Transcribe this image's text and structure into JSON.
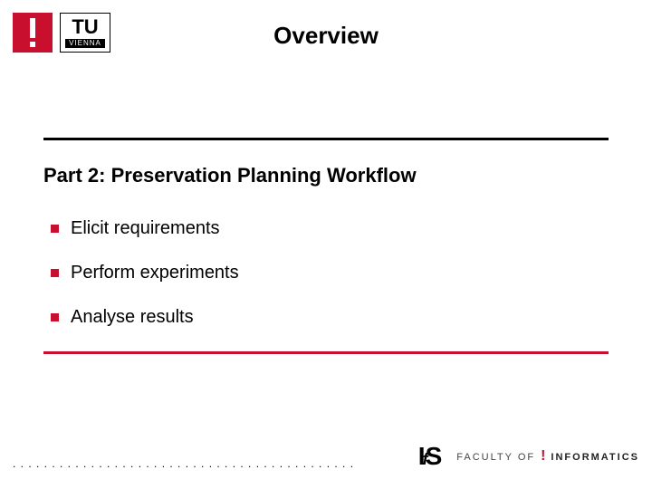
{
  "accent_color": "#c8102e",
  "header": {
    "institution_code": "TU",
    "institution_city": "VIENNA"
  },
  "title": "Overview",
  "subtitle": "Part 2: Preservation Planning Workflow",
  "bullets": [
    "Elicit requirements",
    "Perform experiments",
    "Analyse results"
  ],
  "footer": {
    "ifs_logo_text": {
      "i": "I",
      "f": "f",
      "s": "S"
    },
    "faculty_label_prefix": "FACULTY OF ",
    "faculty_label_name": "INFORMATICS"
  }
}
